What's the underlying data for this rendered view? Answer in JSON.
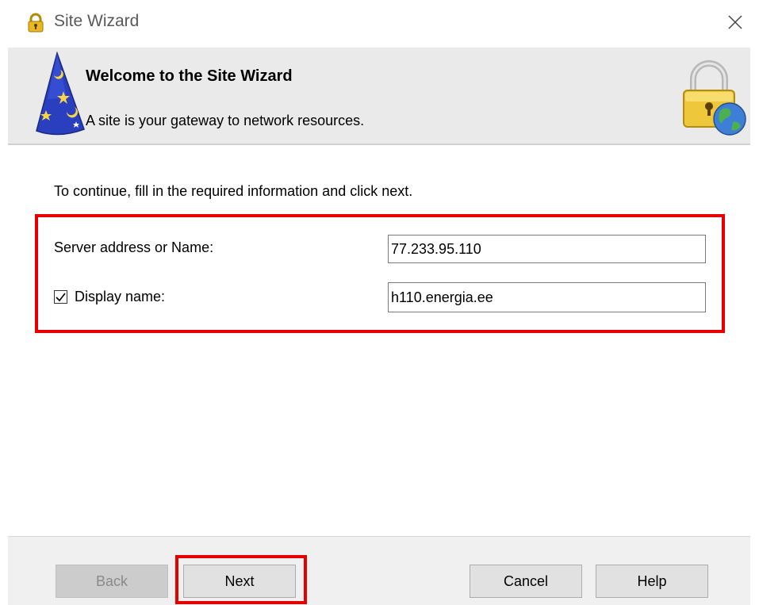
{
  "window": {
    "title": "Site Wizard",
    "close_icon": "close-icon"
  },
  "header": {
    "title": "Welcome to the Site Wizard",
    "subtitle": "A site is your gateway to network resources.",
    "left_icon": "wizard-hat-icon",
    "right_icon": "lock-globe-icon"
  },
  "main": {
    "instructions": "To continue, fill in the required information and click next.",
    "server_label": "Server address or Name:",
    "server_value": "77.233.95.110",
    "display_label": "Display name:",
    "display_checked": true,
    "display_value": "h110.energia.ee"
  },
  "buttons": {
    "back": "Back",
    "next": "Next",
    "cancel": "Cancel",
    "help": "Help"
  },
  "colors": {
    "highlight": "#e60000",
    "header_bg": "#eaeaea",
    "footer_bg": "#f0f0f0"
  }
}
